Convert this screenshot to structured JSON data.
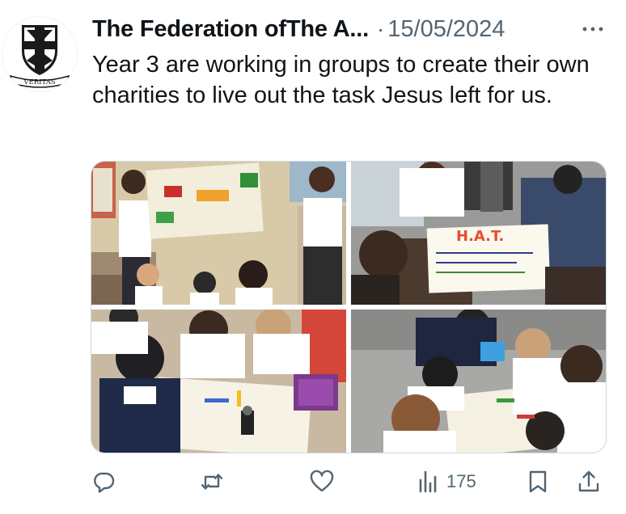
{
  "post": {
    "author": "The Federation ofThe A...",
    "separator": "·",
    "date": "15/05/2024",
    "text": "Year 3 are working in groups to create their own charities to live out the task Jesus left for us.",
    "avatar_motto": "VERITAS",
    "photo_sign_text": "H.A.T.",
    "views": "175"
  },
  "icons": {
    "reply": "reply-icon",
    "repost": "repost-icon",
    "like": "like-icon",
    "views": "views-icon",
    "bookmark": "bookmark-icon",
    "share": "share-icon",
    "more": "more-icon"
  },
  "colors": {
    "text": "#0f1419",
    "secondary": "#536471",
    "border": "#cfd9de"
  }
}
